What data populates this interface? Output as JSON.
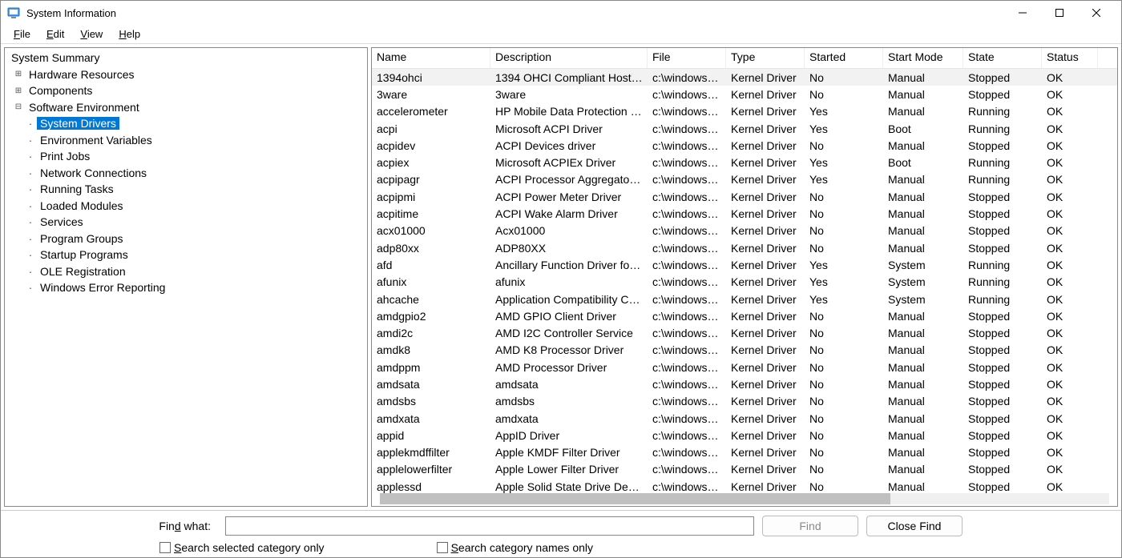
{
  "window": {
    "title": "System Information"
  },
  "menu": {
    "file": "File",
    "edit": "Edit",
    "view": "View",
    "help": "Help"
  },
  "tree": {
    "root": "System Summary",
    "hardware": "Hardware Resources",
    "components": "Components",
    "software_env": "Software Environment",
    "items": [
      "System Drivers",
      "Environment Variables",
      "Print Jobs",
      "Network Connections",
      "Running Tasks",
      "Loaded Modules",
      "Services",
      "Program Groups",
      "Startup Programs",
      "OLE Registration",
      "Windows Error Reporting"
    ]
  },
  "table": {
    "headers": {
      "name": "Name",
      "description": "Description",
      "file": "File",
      "type": "Type",
      "started": "Started",
      "start_mode": "Start Mode",
      "state": "State",
      "status": "Status"
    },
    "rows": [
      {
        "name": "1394ohci",
        "description": "1394 OHCI Compliant Host C...",
        "file": "c:\\windows\\s...",
        "type": "Kernel Driver",
        "started": "No",
        "start_mode": "Manual",
        "state": "Stopped",
        "status": "OK"
      },
      {
        "name": "3ware",
        "description": "3ware",
        "file": "c:\\windows\\s...",
        "type": "Kernel Driver",
        "started": "No",
        "start_mode": "Manual",
        "state": "Stopped",
        "status": "OK"
      },
      {
        "name": "accelerometer",
        "description": "HP Mobile Data Protection S...",
        "file": "c:\\windows\\s...",
        "type": "Kernel Driver",
        "started": "Yes",
        "start_mode": "Manual",
        "state": "Running",
        "status": "OK"
      },
      {
        "name": "acpi",
        "description": "Microsoft ACPI Driver",
        "file": "c:\\windows\\s...",
        "type": "Kernel Driver",
        "started": "Yes",
        "start_mode": "Boot",
        "state": "Running",
        "status": "OK"
      },
      {
        "name": "acpidev",
        "description": "ACPI Devices driver",
        "file": "c:\\windows\\s...",
        "type": "Kernel Driver",
        "started": "No",
        "start_mode": "Manual",
        "state": "Stopped",
        "status": "OK"
      },
      {
        "name": "acpiex",
        "description": "Microsoft ACPIEx Driver",
        "file": "c:\\windows\\s...",
        "type": "Kernel Driver",
        "started": "Yes",
        "start_mode": "Boot",
        "state": "Running",
        "status": "OK"
      },
      {
        "name": "acpipagr",
        "description": "ACPI Processor Aggregator D...",
        "file": "c:\\windows\\s...",
        "type": "Kernel Driver",
        "started": "Yes",
        "start_mode": "Manual",
        "state": "Running",
        "status": "OK"
      },
      {
        "name": "acpipmi",
        "description": "ACPI Power Meter Driver",
        "file": "c:\\windows\\s...",
        "type": "Kernel Driver",
        "started": "No",
        "start_mode": "Manual",
        "state": "Stopped",
        "status": "OK"
      },
      {
        "name": "acpitime",
        "description": "ACPI Wake Alarm Driver",
        "file": "c:\\windows\\s...",
        "type": "Kernel Driver",
        "started": "No",
        "start_mode": "Manual",
        "state": "Stopped",
        "status": "OK"
      },
      {
        "name": "acx01000",
        "description": "Acx01000",
        "file": "c:\\windows\\s...",
        "type": "Kernel Driver",
        "started": "No",
        "start_mode": "Manual",
        "state": "Stopped",
        "status": "OK"
      },
      {
        "name": "adp80xx",
        "description": "ADP80XX",
        "file": "c:\\windows\\s...",
        "type": "Kernel Driver",
        "started": "No",
        "start_mode": "Manual",
        "state": "Stopped",
        "status": "OK"
      },
      {
        "name": "afd",
        "description": "Ancillary Function Driver for ...",
        "file": "c:\\windows\\s...",
        "type": "Kernel Driver",
        "started": "Yes",
        "start_mode": "System",
        "state": "Running",
        "status": "OK"
      },
      {
        "name": "afunix",
        "description": "afunix",
        "file": "c:\\windows\\s...",
        "type": "Kernel Driver",
        "started": "Yes",
        "start_mode": "System",
        "state": "Running",
        "status": "OK"
      },
      {
        "name": "ahcache",
        "description": "Application Compatibility Cac...",
        "file": "c:\\windows\\s...",
        "type": "Kernel Driver",
        "started": "Yes",
        "start_mode": "System",
        "state": "Running",
        "status": "OK"
      },
      {
        "name": "amdgpio2",
        "description": "AMD GPIO Client Driver",
        "file": "c:\\windows\\s...",
        "type": "Kernel Driver",
        "started": "No",
        "start_mode": "Manual",
        "state": "Stopped",
        "status": "OK"
      },
      {
        "name": "amdi2c",
        "description": "AMD I2C Controller Service",
        "file": "c:\\windows\\s...",
        "type": "Kernel Driver",
        "started": "No",
        "start_mode": "Manual",
        "state": "Stopped",
        "status": "OK"
      },
      {
        "name": "amdk8",
        "description": "AMD K8 Processor Driver",
        "file": "c:\\windows\\s...",
        "type": "Kernel Driver",
        "started": "No",
        "start_mode": "Manual",
        "state": "Stopped",
        "status": "OK"
      },
      {
        "name": "amdppm",
        "description": "AMD Processor Driver",
        "file": "c:\\windows\\s...",
        "type": "Kernel Driver",
        "started": "No",
        "start_mode": "Manual",
        "state": "Stopped",
        "status": "OK"
      },
      {
        "name": "amdsata",
        "description": "amdsata",
        "file": "c:\\windows\\s...",
        "type": "Kernel Driver",
        "started": "No",
        "start_mode": "Manual",
        "state": "Stopped",
        "status": "OK"
      },
      {
        "name": "amdsbs",
        "description": "amdsbs",
        "file": "c:\\windows\\s...",
        "type": "Kernel Driver",
        "started": "No",
        "start_mode": "Manual",
        "state": "Stopped",
        "status": "OK"
      },
      {
        "name": "amdxata",
        "description": "amdxata",
        "file": "c:\\windows\\s...",
        "type": "Kernel Driver",
        "started": "No",
        "start_mode": "Manual",
        "state": "Stopped",
        "status": "OK"
      },
      {
        "name": "appid",
        "description": "AppID Driver",
        "file": "c:\\windows\\s...",
        "type": "Kernel Driver",
        "started": "No",
        "start_mode": "Manual",
        "state": "Stopped",
        "status": "OK"
      },
      {
        "name": "applekmdffilter",
        "description": "Apple KMDF Filter Driver",
        "file": "c:\\windows\\s...",
        "type": "Kernel Driver",
        "started": "No",
        "start_mode": "Manual",
        "state": "Stopped",
        "status": "OK"
      },
      {
        "name": "applelowerfilter",
        "description": "Apple Lower Filter Driver",
        "file": "c:\\windows\\s...",
        "type": "Kernel Driver",
        "started": "No",
        "start_mode": "Manual",
        "state": "Stopped",
        "status": "OK"
      },
      {
        "name": "applessd",
        "description": "Apple Solid State Drive Device",
        "file": "c:\\windows\\s...",
        "type": "Kernel Driver",
        "started": "No",
        "start_mode": "Manual",
        "state": "Stopped",
        "status": "OK"
      }
    ]
  },
  "find": {
    "label": "Find what:",
    "find_btn": "Find",
    "close_btn": "Close Find",
    "opt1": "Search selected category only",
    "opt2": "Search category names only"
  }
}
